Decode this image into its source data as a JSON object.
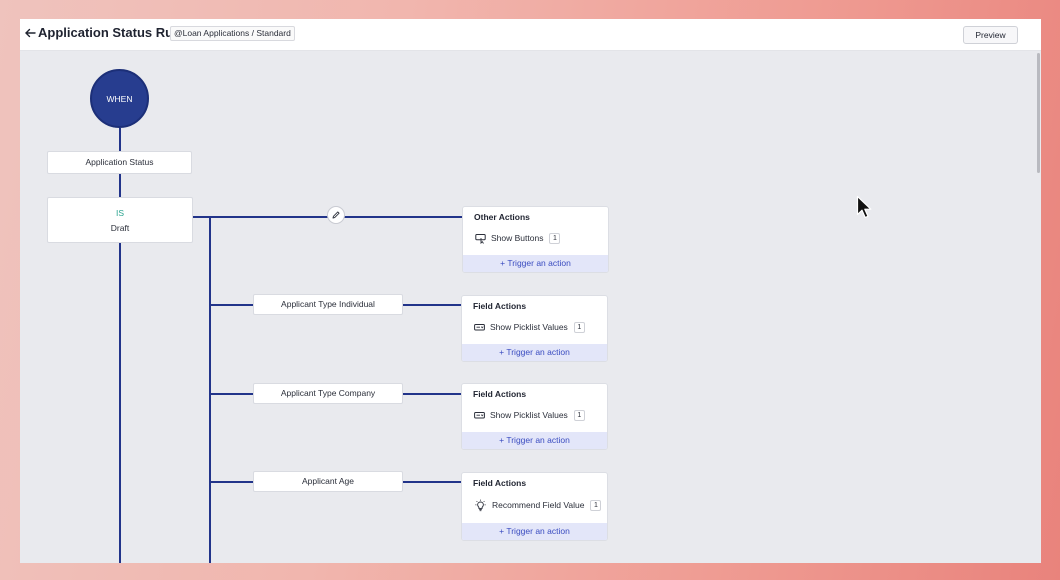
{
  "header": {
    "title": "Application Status Rule",
    "module_badge": "@Loan Applications / Standard",
    "preview_label": "Preview"
  },
  "flow": {
    "when_label": "WHEN",
    "field_label": "Application Status",
    "condition": {
      "operator": "IS",
      "value": "Draft"
    },
    "primary_actions": {
      "title": "Other Actions",
      "item": "Show Buttons",
      "item_icon": "show-buttons-icon",
      "count": "1",
      "trigger": "+ Trigger an action"
    },
    "branches": [
      {
        "label": "Applicant Type Individual",
        "card_title": "Field Actions",
        "item": "Show Picklist Values",
        "item_icon": "picklist-icon",
        "count": "1",
        "trigger": "+ Trigger an action"
      },
      {
        "label": "Applicant Type Company",
        "card_title": "Field Actions",
        "item": "Show Picklist Values",
        "item_icon": "picklist-icon",
        "count": "1",
        "trigger": "+ Trigger an action"
      },
      {
        "label": "Applicant Age",
        "card_title": "Field Actions",
        "item": "Recommend Field Value",
        "item_icon": "lightbulb-icon",
        "count": "1",
        "trigger": "+ Trigger an action"
      }
    ]
  },
  "colors": {
    "accent": "#273d8f",
    "connector": "#22348a",
    "operator": "#2aa48f",
    "trigger_bg": "#e3e6f9",
    "trigger_text": "#3a4cc0"
  }
}
